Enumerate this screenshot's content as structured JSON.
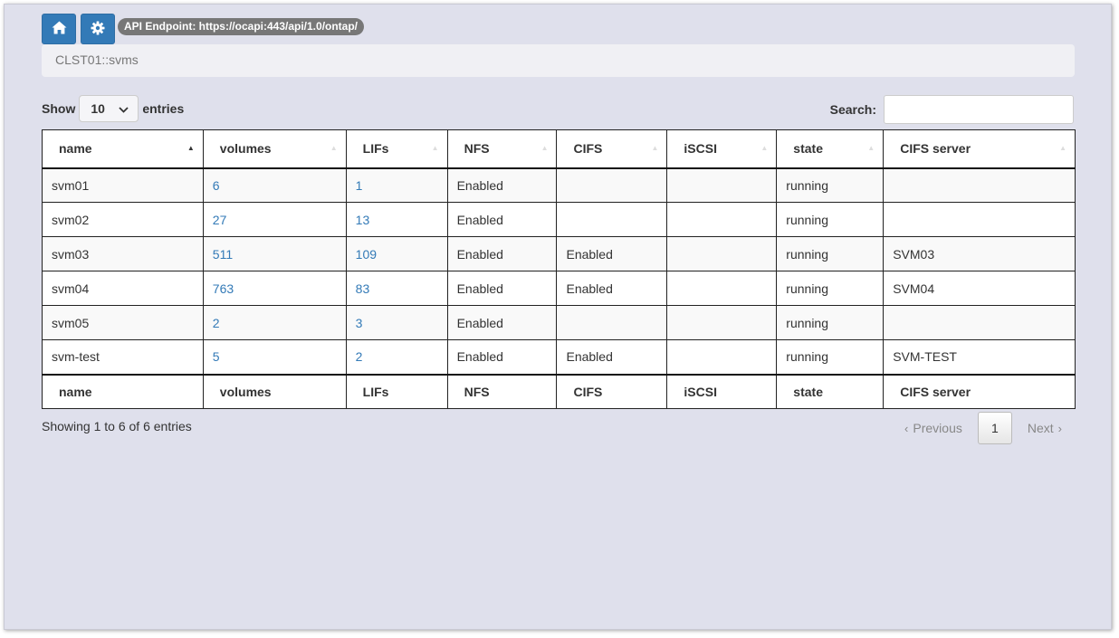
{
  "toolbar": {
    "home_icon": "home-icon",
    "settings_icon": "gear-icon",
    "endpoint_label": "API Endpoint: https://ocapi:443/api/1.0/ontap/"
  },
  "breadcrumb": "CLST01::svms",
  "length": {
    "show": "Show",
    "value": "10",
    "entries": "entries"
  },
  "search": {
    "label": "Search:",
    "value": ""
  },
  "table": {
    "columns": [
      "name",
      "volumes",
      "LIFs",
      "NFS",
      "CIFS",
      "iSCSI",
      "state",
      "CIFS server"
    ],
    "sorted_column": "name",
    "rows": [
      {
        "name": "svm01",
        "volumes": "6",
        "lifs": "1",
        "nfs": "Enabled",
        "cifs": "",
        "iscsi": "",
        "state": "running",
        "cifs_server": ""
      },
      {
        "name": "svm02",
        "volumes": "27",
        "lifs": "13",
        "nfs": "Enabled",
        "cifs": "",
        "iscsi": "",
        "state": "running",
        "cifs_server": ""
      },
      {
        "name": "svm03",
        "volumes": "511",
        "lifs": "109",
        "nfs": "Enabled",
        "cifs": "Enabled",
        "iscsi": "",
        "state": "running",
        "cifs_server": "SVM03"
      },
      {
        "name": "svm04",
        "volumes": "763",
        "lifs": "83",
        "nfs": "Enabled",
        "cifs": "Enabled",
        "iscsi": "",
        "state": "running",
        "cifs_server": "SVM04"
      },
      {
        "name": "svm05",
        "volumes": "2",
        "lifs": "3",
        "nfs": "Enabled",
        "cifs": "",
        "iscsi": "",
        "state": "running",
        "cifs_server": ""
      },
      {
        "name": "svm-test",
        "volumes": "5",
        "lifs": "2",
        "nfs": "Enabled",
        "cifs": "Enabled",
        "iscsi": "",
        "state": "running",
        "cifs_server": "SVM-TEST"
      }
    ]
  },
  "info": "Showing 1 to 6 of 6 entries",
  "pagination": {
    "previous": "Previous",
    "current": "1",
    "next": "Next"
  },
  "colors": {
    "primary": "#337ab7",
    "background": "#dfe0ec",
    "badge": "#777777"
  }
}
